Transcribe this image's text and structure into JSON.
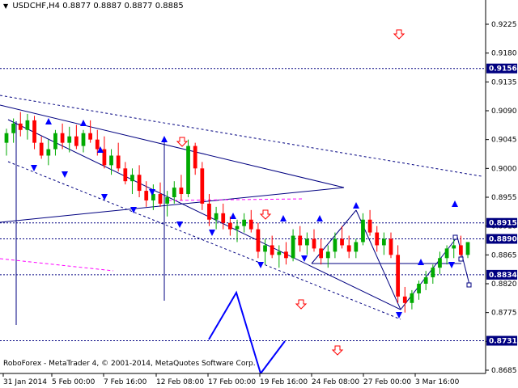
{
  "window": {
    "symbol": "USDCHF,H4",
    "ohlc": "0.8877 0.8887 0.8877 0.8885",
    "footer": "RoboForex - MetaTrader 4, © 2001-2014, MetaQuotes Software Corp."
  },
  "chart_data": {
    "type": "candlestick",
    "ylim": [
      0.8665,
      0.9265
    ],
    "y_ticks": [
      {
        "label": "0.9225",
        "value": 0.9225
      },
      {
        "label": "0.9180",
        "value": 0.918
      },
      {
        "label": "0.9135",
        "value": 0.9135
      },
      {
        "label": "0.9090",
        "value": 0.909
      },
      {
        "label": "0.9045",
        "value": 0.9045
      },
      {
        "label": "0.9000",
        "value": 0.9
      },
      {
        "label": "0.8955",
        "value": 0.8955
      },
      {
        "label": "0.8910",
        "value": 0.891
      },
      {
        "label": "0.8865",
        "value": 0.8865
      },
      {
        "label": "0.8820",
        "value": 0.882
      },
      {
        "label": "0.8775",
        "value": 0.8775
      },
      {
        "label": "0.8730",
        "value": 0.873
      },
      {
        "label": "0.8685",
        "value": 0.8685
      }
    ],
    "price_tags": [
      {
        "label": "0.9156",
        "value": 0.9156,
        "color": "#000080"
      },
      {
        "label": "0.8915",
        "value": 0.8915,
        "color": "#000080"
      },
      {
        "label": "0.8890",
        "value": 0.889,
        "color": "#000080"
      },
      {
        "label": "0.8834",
        "value": 0.8834,
        "color": "#000080"
      },
      {
        "label": "0.8731",
        "value": 0.8731,
        "color": "#000080"
      }
    ],
    "x_labels": [
      "31 Jan 2014",
      "5 Feb 00:00",
      "7 Feb 16:00",
      "12 Feb 08:00",
      "17 Feb 00:00",
      "19 Feb 16:00",
      "24 Feb 08:00",
      "27 Feb 00:00",
      "3 Mar 16:00"
    ],
    "colors": {
      "bull": "#00aa00",
      "bear": "#ff0000",
      "line": "#000080",
      "tag_bg": "#000080",
      "arrow_blue": "#0000ff",
      "arrow_red": "#ff0000",
      "dash_magenta": "#ff00ff"
    },
    "candles": [
      [
        0.904,
        0.9062,
        0.902,
        0.9055
      ],
      [
        0.9055,
        0.9078,
        0.904,
        0.907
      ],
      [
        0.907,
        0.9088,
        0.905,
        0.906
      ],
      [
        0.906,
        0.9085,
        0.9045,
        0.9075
      ],
      [
        0.9075,
        0.9082,
        0.903,
        0.904
      ],
      [
        0.904,
        0.905,
        0.9015,
        0.902
      ],
      [
        0.902,
        0.9045,
        0.9005,
        0.903
      ],
      [
        0.903,
        0.906,
        0.902,
        0.9055
      ],
      [
        0.9055,
        0.907,
        0.903,
        0.904
      ],
      [
        0.904,
        0.9065,
        0.9025,
        0.905
      ],
      [
        0.905,
        0.9068,
        0.903,
        0.9035
      ],
      [
        0.9035,
        0.906,
        0.9025,
        0.9055
      ],
      [
        0.9055,
        0.9075,
        0.904,
        0.9045
      ],
      [
        0.9045,
        0.906,
        0.902,
        0.903
      ],
      [
        0.903,
        0.905,
        0.9,
        0.9005
      ],
      [
        0.9005,
        0.903,
        0.899,
        0.902
      ],
      [
        0.902,
        0.904,
        0.8995,
        0.9
      ],
      [
        0.9,
        0.901,
        0.8975,
        0.898
      ],
      [
        0.898,
        0.9,
        0.896,
        0.899
      ],
      [
        0.899,
        0.9005,
        0.8955,
        0.8965
      ],
      [
        0.8965,
        0.898,
        0.894,
        0.895
      ],
      [
        0.895,
        0.8975,
        0.8935,
        0.896
      ],
      [
        0.896,
        0.8978,
        0.894,
        0.8945
      ],
      [
        0.8945,
        0.8965,
        0.8925,
        0.8955
      ],
      [
        0.8955,
        0.898,
        0.8945,
        0.897
      ],
      [
        0.897,
        0.899,
        0.895,
        0.896
      ],
      [
        0.896,
        0.9045,
        0.8955,
        0.9035
      ],
      [
        0.9035,
        0.904,
        0.899,
        0.9
      ],
      [
        0.9,
        0.901,
        0.8935,
        0.8945
      ],
      [
        0.8945,
        0.896,
        0.891,
        0.892
      ],
      [
        0.892,
        0.894,
        0.8905,
        0.893
      ],
      [
        0.893,
        0.8945,
        0.8905,
        0.8915
      ],
      [
        0.8915,
        0.8925,
        0.8895,
        0.8905
      ],
      [
        0.8905,
        0.892,
        0.8885,
        0.891
      ],
      [
        0.891,
        0.893,
        0.89,
        0.892
      ],
      [
        0.892,
        0.8935,
        0.89,
        0.8905
      ],
      [
        0.8905,
        0.8915,
        0.886,
        0.887
      ],
      [
        0.887,
        0.889,
        0.885,
        0.888
      ],
      [
        0.888,
        0.8895,
        0.886,
        0.8865
      ],
      [
        0.8865,
        0.888,
        0.8845,
        0.887
      ],
      [
        0.887,
        0.8885,
        0.885,
        0.886
      ],
      [
        0.886,
        0.8905,
        0.8855,
        0.8895
      ],
      [
        0.8895,
        0.891,
        0.887,
        0.888
      ],
      [
        0.888,
        0.89,
        0.8865,
        0.889
      ],
      [
        0.889,
        0.8905,
        0.887,
        0.8875
      ],
      [
        0.8875,
        0.889,
        0.885,
        0.886
      ],
      [
        0.886,
        0.888,
        0.8845,
        0.887
      ],
      [
        0.887,
        0.89,
        0.886,
        0.889
      ],
      [
        0.889,
        0.891,
        0.8875,
        0.888
      ],
      [
        0.888,
        0.8895,
        0.886,
        0.887
      ],
      [
        0.887,
        0.889,
        0.886,
        0.8885
      ],
      [
        0.8885,
        0.893,
        0.888,
        0.892
      ],
      [
        0.892,
        0.8935,
        0.8895,
        0.89
      ],
      [
        0.89,
        0.891,
        0.887,
        0.888
      ],
      [
        0.888,
        0.89,
        0.8865,
        0.889
      ],
      [
        0.889,
        0.89,
        0.886,
        0.8865
      ],
      [
        0.8865,
        0.888,
        0.879,
        0.88
      ],
      [
        0.88,
        0.8815,
        0.8775,
        0.879
      ],
      [
        0.879,
        0.881,
        0.878,
        0.8805
      ],
      [
        0.8805,
        0.8825,
        0.8795,
        0.882
      ],
      [
        0.882,
        0.884,
        0.881,
        0.883
      ],
      [
        0.883,
        0.885,
        0.882,
        0.8845
      ],
      [
        0.8845,
        0.887,
        0.8835,
        0.886
      ],
      [
        0.886,
        0.888,
        0.885,
        0.8875
      ],
      [
        0.8875,
        0.889,
        0.886,
        0.888
      ],
      [
        0.888,
        0.8895,
        0.886,
        0.8865
      ],
      [
        0.8865,
        0.8885,
        0.886,
        0.8885
      ]
    ]
  }
}
